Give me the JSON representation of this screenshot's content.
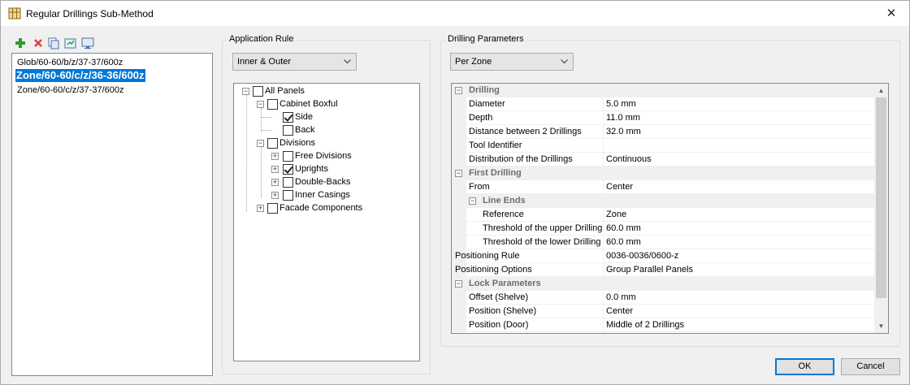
{
  "window": {
    "title": "Regular Drillings Sub-Method",
    "close_glyph": "✕"
  },
  "toolbar": {
    "icons": [
      "add-icon",
      "delete-icon",
      "copy-icon",
      "edit-icon",
      "display-icon"
    ],
    "colors": {
      "add": "#2e9e2e",
      "delete": "#e04040"
    }
  },
  "methods": {
    "items": [
      "Glob/60-60/b/z/37-37/600z",
      "Zone/60-60/c/z/36-36/600z",
      "Zone/60-60/c/z/37-37/600z"
    ],
    "selected_index": 1
  },
  "application_rule": {
    "label": "Application Rule",
    "combo_value": "Inner & Outer",
    "tree": [
      {
        "label": "All Panels",
        "checked": false,
        "expander": "−",
        "level": 0
      },
      {
        "label": "Cabinet Boxful",
        "checked": false,
        "expander": "−",
        "level": 1
      },
      {
        "label": "Side",
        "checked": true,
        "expander": "",
        "level": 2
      },
      {
        "label": "Back",
        "checked": false,
        "expander": "",
        "level": 2
      },
      {
        "label": "Divisions",
        "checked": false,
        "expander": "−",
        "level": 1
      },
      {
        "label": "Free Divisions",
        "checked": false,
        "expander": "+",
        "level": 2
      },
      {
        "label": "Uprights",
        "checked": true,
        "expander": "+",
        "level": 2
      },
      {
        "label": "Double-Backs",
        "checked": false,
        "expander": "+",
        "level": 2
      },
      {
        "label": "Inner Casings",
        "checked": false,
        "expander": "+",
        "level": 2
      },
      {
        "label": "Facade Components",
        "checked": false,
        "expander": "+",
        "level": 1
      }
    ]
  },
  "drilling_parameters": {
    "label": "Drilling Parameters",
    "combo_value": "Per Zone",
    "rows": [
      {
        "type": "cat",
        "level": 0,
        "name": "Drilling"
      },
      {
        "type": "prop",
        "level": 1,
        "name": "Diameter",
        "value": "5.0 mm"
      },
      {
        "type": "prop",
        "level": 1,
        "name": "Depth",
        "value": "11.0 mm"
      },
      {
        "type": "prop",
        "level": 1,
        "name": "Distance between 2 Drillings",
        "value": "32.0 mm"
      },
      {
        "type": "prop",
        "level": 1,
        "name": "Tool Identifier",
        "value": ""
      },
      {
        "type": "prop",
        "level": 1,
        "name": "Distribution of the Drillings",
        "value": "Continuous"
      },
      {
        "type": "cat",
        "level": 0,
        "name": "First Drilling"
      },
      {
        "type": "prop",
        "level": 1,
        "name": "From",
        "value": "Center"
      },
      {
        "type": "cat",
        "level": 1,
        "name": "Line Ends"
      },
      {
        "type": "prop",
        "level": 2,
        "name": "Reference",
        "value": "Zone"
      },
      {
        "type": "prop",
        "level": 2,
        "name": "Threshold of the upper Drilling",
        "value": "60.0 mm"
      },
      {
        "type": "prop",
        "level": 2,
        "name": "Threshold of the lower Drilling",
        "value": "60.0 mm"
      },
      {
        "type": "prop",
        "level": 0,
        "name": "Positioning Rule",
        "value": "0036-0036/0600-z"
      },
      {
        "type": "prop",
        "level": 0,
        "name": "Positioning Options",
        "value": "Group Parallel Panels"
      },
      {
        "type": "cat",
        "level": 0,
        "name": "Lock Parameters"
      },
      {
        "type": "prop",
        "level": 1,
        "name": "Offset (Shelve)",
        "value": "0.0 mm"
      },
      {
        "type": "prop",
        "level": 1,
        "name": "Position (Shelve)",
        "value": "Center"
      },
      {
        "type": "prop",
        "level": 1,
        "name": "Position (Door)",
        "value": "Middle of 2 Drillings"
      }
    ]
  },
  "buttons": {
    "ok": "OK",
    "cancel": "Cancel"
  },
  "colors": {
    "selection": "#0078d7",
    "category_text": "#6d6d6d"
  }
}
